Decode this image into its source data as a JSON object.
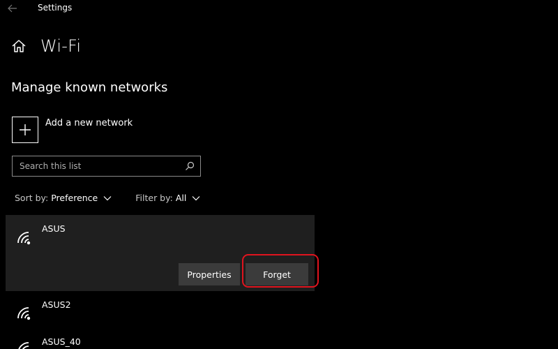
{
  "window": {
    "title": "Settings"
  },
  "header": {
    "title": "Wi-Fi"
  },
  "section": {
    "title": "Manage known networks"
  },
  "add_network": {
    "label": "Add a new network"
  },
  "search": {
    "placeholder": "Search this list"
  },
  "filters": {
    "sort_label": "Sort by:",
    "sort_value": "Preference",
    "filter_label": "Filter by:",
    "filter_value": "All"
  },
  "networks": [
    {
      "name": "ASUS"
    },
    {
      "name": "ASUS2"
    },
    {
      "name": "ASUS_40"
    }
  ],
  "actions": {
    "properties_label": "Properties",
    "forget_label": "Forget"
  },
  "colors": {
    "background": "#000000",
    "selected_row": "#1f1f1f",
    "button": "#3b3b3b",
    "highlight": "#e0141e"
  }
}
